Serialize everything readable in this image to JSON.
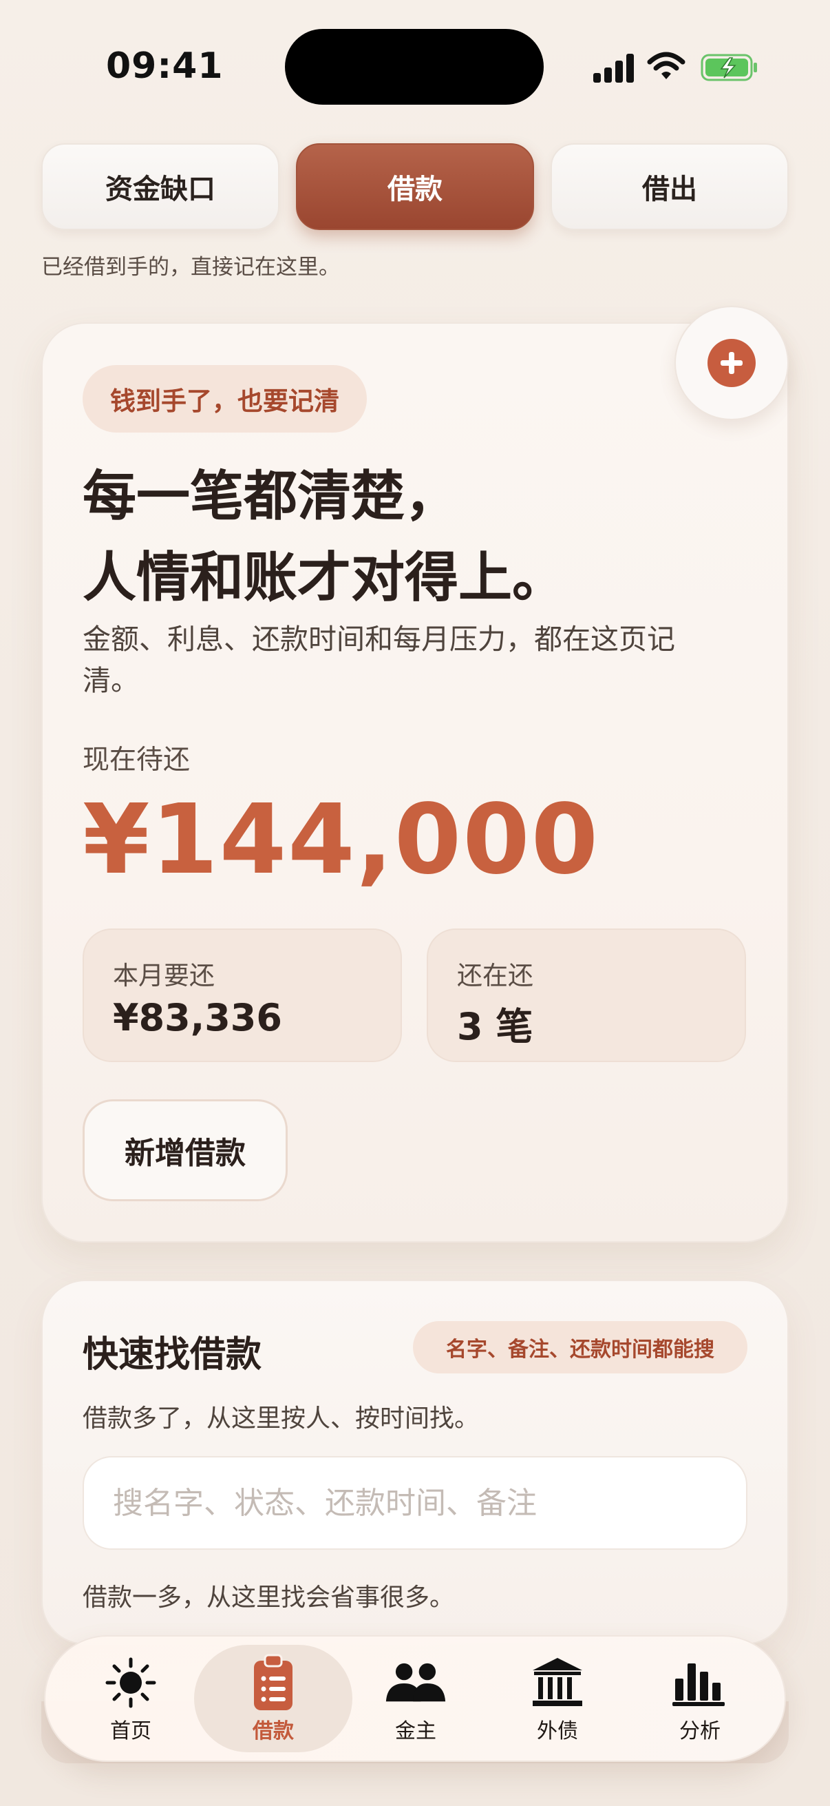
{
  "status": {
    "time": "09:41"
  },
  "tabs": [
    {
      "label": "资金缺口"
    },
    {
      "label": "借款"
    },
    {
      "label": "借出"
    }
  ],
  "hint_top": "已经借到手的，直接记在这里。",
  "hero": {
    "tag": "钱到手了，也要记清",
    "headline_line1": "每一笔都清楚，",
    "headline_line2": "人情和账才对得上。",
    "description": "金额、利息、还款时间和每月压力，都在这页记清。",
    "due_label": "现在待还",
    "due_amount": "¥144,000",
    "stats": [
      {
        "label": "本月要还",
        "value": "¥83,336"
      },
      {
        "label": "还在还",
        "value": "3 笔"
      }
    ],
    "add_button": "新增借款"
  },
  "search": {
    "title": "快速找借款",
    "tag": "名字、备注、还款时间都能搜",
    "subtitle": "借款多了，从这里按人、按时间找。",
    "placeholder": "搜名字、状态、还款时间、备注",
    "value": "",
    "footer": "借款一多，从这里找会省事很多。"
  },
  "nav": [
    {
      "label": "首页",
      "icon": "sun-icon"
    },
    {
      "label": "借款",
      "icon": "clipboard-icon"
    },
    {
      "label": "金主",
      "icon": "people-icon"
    },
    {
      "label": "外债",
      "icon": "bank-icon"
    },
    {
      "label": "分析",
      "icon": "bar-chart-icon"
    }
  ],
  "colors": {
    "accent": "#c8613f",
    "tab_active": "#a3533b",
    "tag_bg": "#f5e4da",
    "tag_text": "#a6482d"
  }
}
